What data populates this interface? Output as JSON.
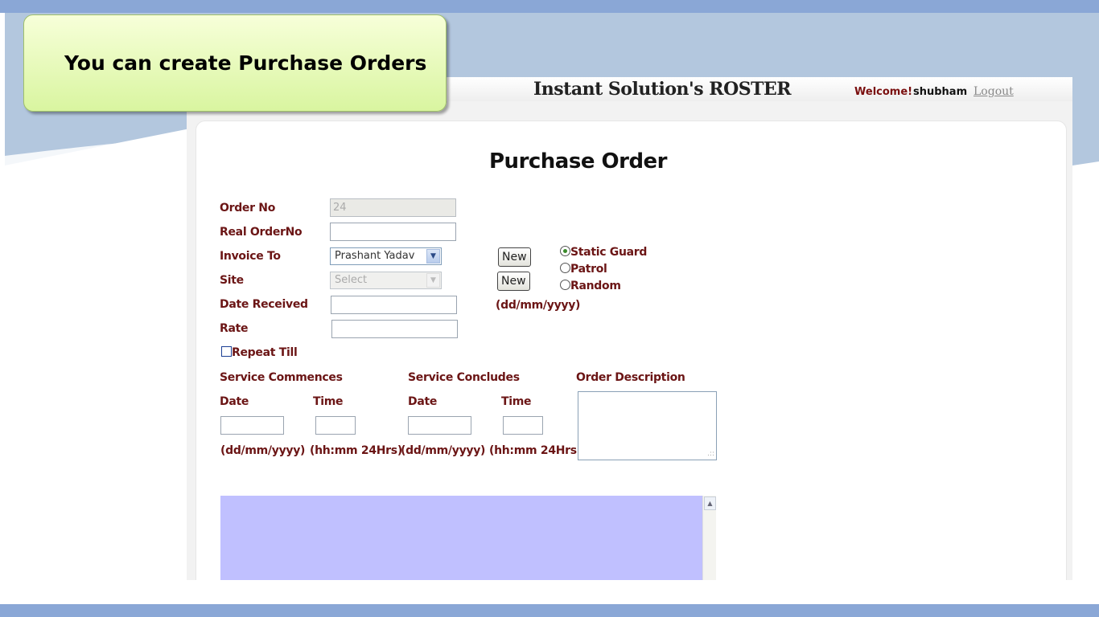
{
  "callout": {
    "text": "You can create Purchase Orders"
  },
  "header": {
    "title": "Instant Solution's ROSTER",
    "welcome": "Welcome!",
    "username": "shubham",
    "logout": "Logout"
  },
  "form": {
    "title": "Purchase Order",
    "order_no": {
      "label": "Order No",
      "value": "24"
    },
    "real_order_no": {
      "label": "Real OrderNo",
      "value": ""
    },
    "invoice_to": {
      "label": "Invoice To",
      "selected": "Prashant Yadav",
      "new_label": "New"
    },
    "site": {
      "label": "Site",
      "selected": "Select",
      "new_label": "New"
    },
    "date_received": {
      "label": "Date Received",
      "value": "",
      "hint": "(dd/mm/yyyy)"
    },
    "rate": {
      "label": "Rate",
      "value": ""
    },
    "repeat_till": {
      "label": "Repeat Till",
      "checked": false
    },
    "service_type": {
      "options": [
        "Static Guard",
        "Patrol",
        "Random"
      ],
      "selected": "Static Guard"
    },
    "service_commences": {
      "label": "Service Commences",
      "date_label": "Date",
      "time_label": "Time",
      "date_hint": "(dd/mm/yyyy)",
      "time_hint": "(hh:mm 24Hrs)",
      "date_value": "",
      "time_value": ""
    },
    "service_concludes": {
      "label": "Service Concludes",
      "date_label": "Date",
      "time_label": "Time",
      "date_hint": "(dd/mm/yyyy)",
      "time_hint": "(hh:mm 24Hrs)",
      "date_value": "",
      "time_value": ""
    },
    "order_description": {
      "label": "Order Description",
      "value": ""
    }
  },
  "colors": {
    "label": "#6b1515",
    "slide_bar": "#8aa7d6",
    "callout_fill": "#d9f5a0",
    "grid_fill": "#c0c0ff"
  }
}
